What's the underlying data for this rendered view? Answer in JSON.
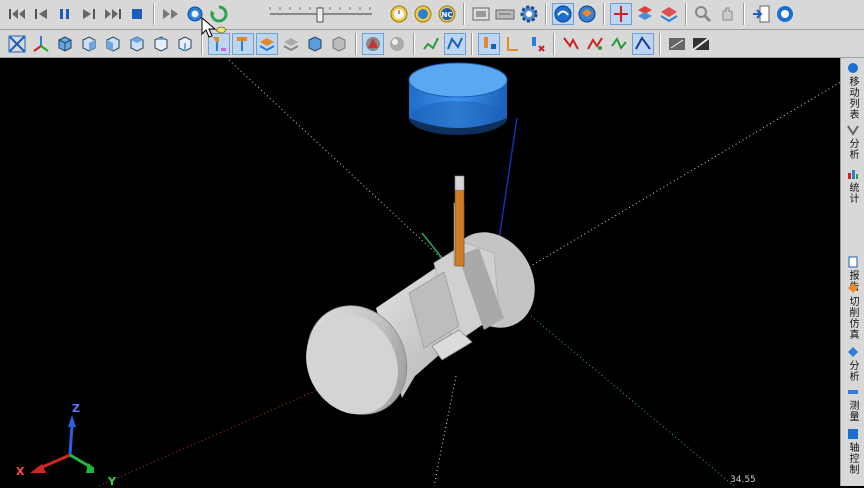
{
  "right_panel": {
    "tabs": [
      {
        "label": "移动列表",
        "icon": "list-icon"
      },
      {
        "label": "分析",
        "icon": "analysis-icon"
      },
      {
        "label": "统计",
        "icon": "stats-icon"
      },
      {
        "label": "报告",
        "icon": "report-icon"
      },
      {
        "label": "切削仿真",
        "icon": "cut-sim-icon"
      },
      {
        "label": "分析",
        "icon": "analysis2-icon"
      },
      {
        "label": "测量",
        "icon": "measure-icon"
      },
      {
        "label": "轴控制",
        "icon": "axis-control-icon"
      }
    ]
  },
  "axes": {
    "x": "X",
    "y": "Y",
    "z": "Z"
  },
  "hud": {
    "text": "34.55"
  },
  "colors": {
    "toolbar": "#d8d8d8",
    "viewport": "#000000",
    "tool_holder": "#2b7fd6",
    "tool_shank": "#d07a1f",
    "stock": "#c8c8c8"
  },
  "playback": {
    "slider_position": 0.5
  }
}
